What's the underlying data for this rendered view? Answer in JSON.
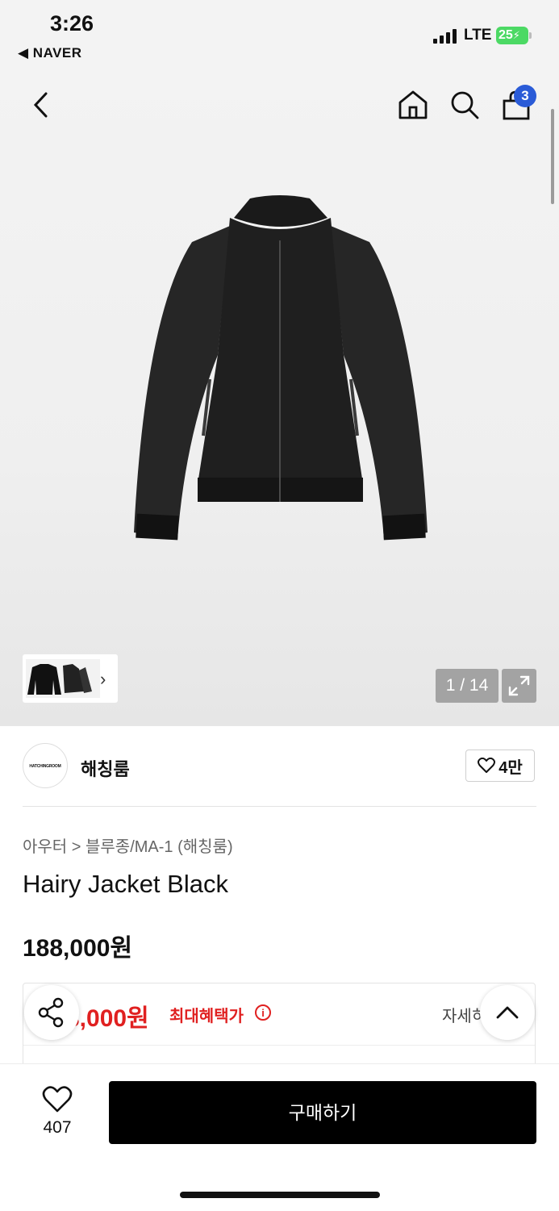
{
  "status_bar": {
    "time": "3:26",
    "back_app": "◀ NAVER",
    "network": "LTE",
    "battery": "25"
  },
  "header": {
    "back_icon": "chevron-left-icon",
    "home_icon": "home-icon",
    "search_icon": "search-icon",
    "cart_icon": "shopping-bag-icon",
    "cart_count": "3"
  },
  "gallery": {
    "counter": "1 / 14",
    "thumb_chevron": "›",
    "expand_icon": "expand-icon"
  },
  "brand": {
    "logo_text": "HATCHINGROOM",
    "name": "해칭룸",
    "like_count": "4만"
  },
  "product": {
    "breadcrumb": "아우터 > 블루종/MA-1 (해칭룸)",
    "title": "Hairy Jacket Black",
    "price": "188,000원"
  },
  "benefit": {
    "price": "3,000원",
    "label": "최대혜택가",
    "info_icon": "i",
    "detail": "자세히"
  },
  "bottom_bar": {
    "wish_count": "407",
    "buy_label": "구매하기"
  },
  "colors": {
    "accent_red": "#e02020",
    "badge_blue": "#2a5bd7",
    "buy_button": "#000000"
  }
}
